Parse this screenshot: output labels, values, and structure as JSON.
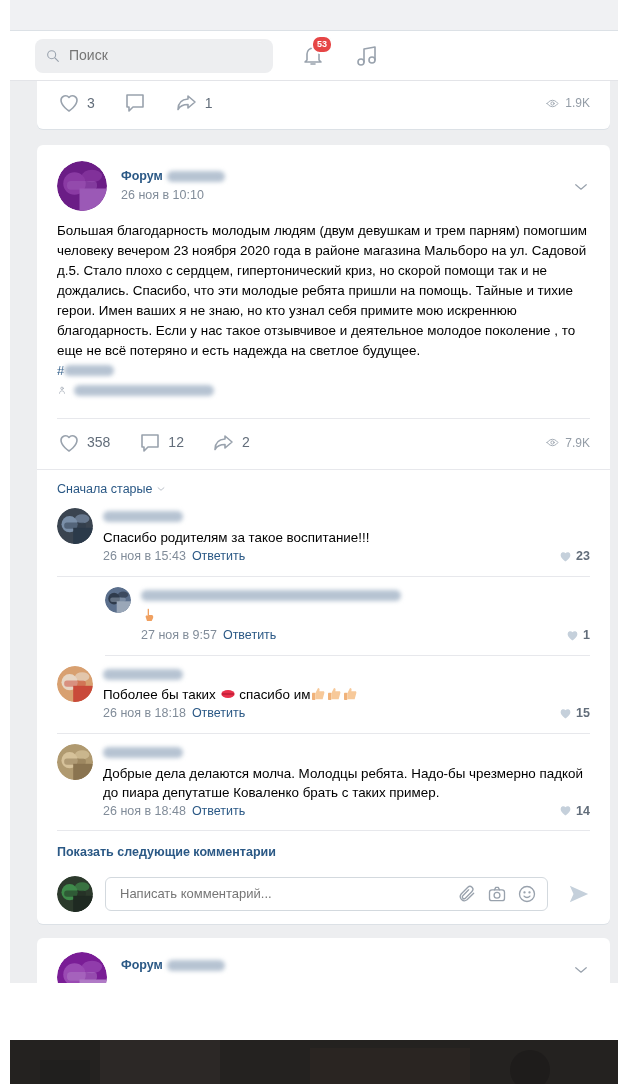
{
  "header": {
    "search": {
      "placeholder": "Поиск"
    },
    "notifications": {
      "badge": "53"
    }
  },
  "prev_post": {
    "likes": "3",
    "shares": "1",
    "views": "1.9K"
  },
  "post": {
    "author": "Форум",
    "time": "26 ноя в 10:10",
    "text": "Большая благодарность молодым людям (двум девушкам и трем парням) помогшим человеку вечером 23 ноября 2020 года в районе магазина Мальборо на ул. Садовой д.5. Стало плохо с сердцем, гипертонический криз, но скорой помощи так и не дождались. Спасибо, что эти молодые ребята пришли на помощь. Тайные и тихие герои. Имен ваших я не знаю, но кто узнал себя примите мою искреннюю благодарность. Если у нас такое отзывчивое и деятельное молодое поколение , то еще не всё потеряно и есть надежда на светлое будущее.",
    "hashtag": "#",
    "likes": "358",
    "comments": "12",
    "shares": "2",
    "views": "7.9K"
  },
  "comments": {
    "sort": "Сначала старые",
    "items": [
      {
        "parts": [
          {
            "kind": "text",
            "text": "Спасибо родителям за такое воспитание!!!"
          }
        ],
        "time": "26 ноя в 15:43",
        "reply": "Ответить",
        "likes": "23",
        "nested": false
      },
      {
        "parts": [
          {
            "kind": "finger"
          }
        ],
        "time": "27 ноя в 9:57",
        "reply": "Ответить",
        "likes": "1",
        "nested": true
      },
      {
        "parts": [
          {
            "kind": "text",
            "text": "Поболее бы таких "
          },
          {
            "kind": "kiss"
          },
          {
            "kind": "text",
            "text": " спасибо им"
          },
          {
            "kind": "thumb"
          },
          {
            "kind": "thumb"
          },
          {
            "kind": "thumb"
          }
        ],
        "time": "26 ноя в 18:18",
        "reply": "Ответить",
        "likes": "15",
        "nested": false
      },
      {
        "parts": [
          {
            "kind": "text",
            "text": "Добрые дела делаются молча. Молодцы ребята. Надо-бы чрезмерно падкой до пиара депутатше Коваленко брать с таких пример."
          }
        ],
        "time": "26 ноя в 18:48",
        "reply": "Ответить",
        "likes": "14",
        "nested": false
      }
    ],
    "more": "Показать следующие комментарии",
    "input": {
      "placeholder": "Написать комментарий..."
    }
  },
  "next_post": {
    "author": "Форум"
  }
}
